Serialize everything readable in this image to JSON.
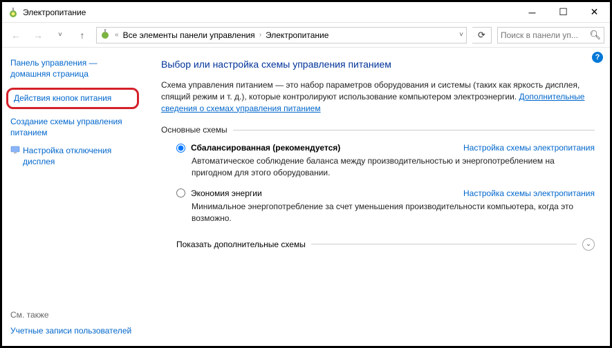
{
  "window": {
    "title": "Электропитание"
  },
  "nav": {
    "crumb1": "Все элементы панели управления",
    "crumb2": "Электропитание",
    "search_placeholder": "Поиск в панели уп..."
  },
  "sidebar": {
    "home": "Панель управления — домашняя страница",
    "link_power_buttons": "Действия кнопок питания",
    "link_create_plan": "Создание схемы управления питанием",
    "link_display_off": "Настройка отключения дисплея",
    "see_also_label": "См. также",
    "see_also_accounts": "Учетные записи пользователей"
  },
  "main": {
    "heading": "Выбор или настройка схемы управления питанием",
    "desc": "Схема управления питанием — это набор параметров оборудования и системы (таких как яркость дисплея, спящий режим и т. д.), которые контролируют использование компьютером электроэнергии.",
    "desc_link": "Дополнительные сведения о схемах управления питанием",
    "legend": "Основные схемы",
    "plan1_label": "Сбалансированная (рекомендуется)",
    "plan1_cfg": "Настройка схемы электропитания",
    "plan1_desc": "Автоматическое соблюдение баланса между производительностью и энергопотреблением на пригодном для этого оборудовании.",
    "plan2_label": "Экономия энергии",
    "plan2_cfg": "Настройка схемы электропитания",
    "plan2_desc": "Минимальное энергопотребление за счет уменьшения производительности компьютера, когда это возможно.",
    "expand": "Показать дополнительные схемы"
  }
}
